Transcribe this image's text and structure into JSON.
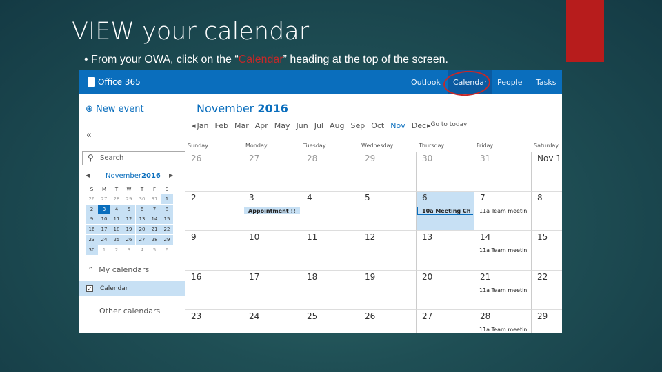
{
  "slide": {
    "title": "VIEW your calendar",
    "bullet_prefix": "•  From your OWA, click on the “",
    "bullet_highlight": "Calendar",
    "bullet_suffix": "” heading at the top of the screen.",
    "accent": "#b71c1c"
  },
  "app": {
    "brand": "Office 365",
    "nav": [
      "Outlook",
      "Calendar",
      "People",
      "Tasks"
    ],
    "active_nav": "Calendar",
    "brand_color": "#0a6ebd"
  },
  "left": {
    "new_event": "New event",
    "collapse": "«",
    "search_placeholder": "Search",
    "mini_title_month": "November",
    "mini_title_year": "2016",
    "weekday_initials": [
      "S",
      "M",
      "T",
      "W",
      "T",
      "F",
      "S"
    ],
    "mini_weeks": [
      [
        "26",
        "27",
        "28",
        "29",
        "30",
        "31",
        "1"
      ],
      [
        "2",
        "3",
        "4",
        "5",
        "6",
        "7",
        "8"
      ],
      [
        "9",
        "10",
        "11",
        "12",
        "13",
        "14",
        "15"
      ],
      [
        "16",
        "17",
        "18",
        "19",
        "20",
        "21",
        "22"
      ],
      [
        "23",
        "24",
        "25",
        "26",
        "27",
        "28",
        "29"
      ],
      [
        "30",
        "1",
        "2",
        "3",
        "4",
        "5",
        "6"
      ]
    ],
    "today": "3",
    "my_calendars": "My calendars",
    "calendar_item": "Calendar",
    "calendar_checked": true,
    "other_calendars": "Other calendars"
  },
  "main": {
    "month": "November",
    "year": "2016",
    "months": [
      "Jan",
      "Feb",
      "Mar",
      "Apr",
      "May",
      "Jun",
      "Jul",
      "Aug",
      "Sep",
      "Oct",
      "Nov",
      "Dec"
    ],
    "current_month": "Nov",
    "go_to_today": "Go to today",
    "weekdays": [
      "Sunday",
      "Monday",
      "Tuesday",
      "Wednesday",
      "Thursday",
      "Friday",
      "Saturday"
    ],
    "weeks": [
      [
        "26",
        "27",
        "28",
        "29",
        "30",
        "31",
        "Nov 1"
      ],
      [
        "2",
        "3",
        "4",
        "5",
        "6",
        "7",
        "8"
      ],
      [
        "9",
        "10",
        "11",
        "12",
        "13",
        "14",
        "15"
      ],
      [
        "16",
        "17",
        "18",
        "19",
        "20",
        "21",
        "22"
      ],
      [
        "23",
        "24",
        "25",
        "26",
        "27",
        "28",
        "29"
      ]
    ],
    "events": [
      {
        "week": 1,
        "day": 1,
        "text": "Appointment  !!"
      },
      {
        "week": 1,
        "day": 4,
        "text": "10a Meeting  Ch"
      },
      {
        "week": 1,
        "day": 5,
        "text": "11a Team meetin"
      },
      {
        "week": 2,
        "day": 5,
        "text": "11a Team meetin"
      },
      {
        "week": 3,
        "day": 5,
        "text": "11a Team meetin"
      },
      {
        "week": 4,
        "day": 5,
        "text": "11a Team meetin"
      }
    ]
  }
}
